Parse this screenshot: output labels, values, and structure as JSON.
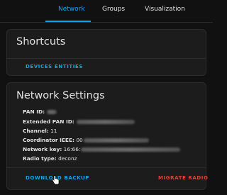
{
  "tabs": [
    {
      "label": "Network",
      "active": true
    },
    {
      "label": "Groups",
      "active": false
    },
    {
      "label": "Visualization",
      "active": false
    }
  ],
  "shortcuts_card": {
    "title": "Shortcuts",
    "actions": [
      "DEVICES",
      "ENTITIES"
    ]
  },
  "network_card": {
    "title": "Network Settings",
    "rows": [
      {
        "label": "PAN ID:",
        "value": ""
      },
      {
        "label": "Extended PAN ID:",
        "value": ""
      },
      {
        "label": "Channel:",
        "value": "11"
      },
      {
        "label": "Coordinator IEEE:",
        "value": "00"
      },
      {
        "label": "Network key:",
        "value": "16:66:"
      },
      {
        "label": "Radio type:",
        "value": "deconz"
      }
    ],
    "actions": {
      "download": "DOWNLOAD BACKUP",
      "migrate": "MIGRATE RADIO"
    }
  },
  "colors": {
    "accent": "#03a9f4",
    "danger": "#db4437",
    "card": "#1c1c1c",
    "background": "#111111"
  }
}
